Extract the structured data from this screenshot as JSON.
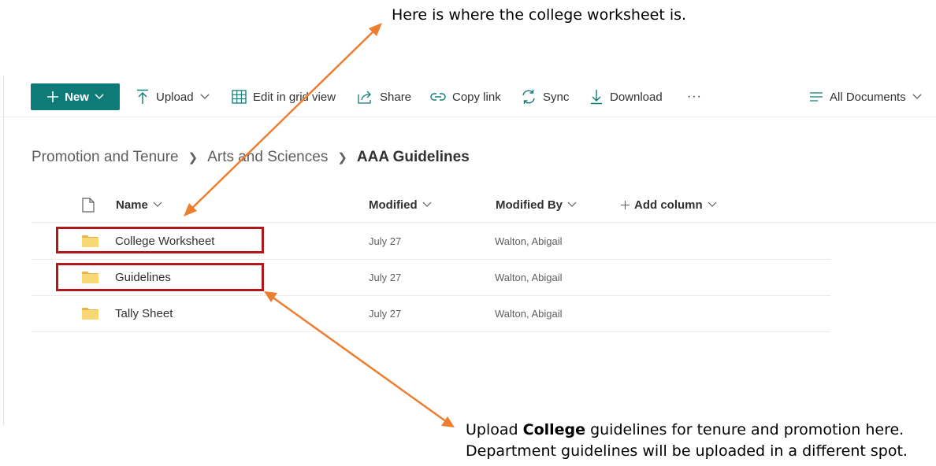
{
  "annotations": {
    "top": "Here is where the college worksheet is.",
    "bottom_line1_prefix": "Upload ",
    "bottom_line1_bold": "College",
    "bottom_line1_suffix": " guidelines for tenure and promotion here.",
    "bottom_line2": "Department guidelines will be uploaded in a different spot."
  },
  "toolbar": {
    "new_label": "New",
    "upload_label": "Upload",
    "edit_grid_label": "Edit in grid view",
    "share_label": "Share",
    "copy_link_label": "Copy link",
    "sync_label": "Sync",
    "download_label": "Download",
    "more_label": "···",
    "view_label": "All Documents"
  },
  "breadcrumb": {
    "items": [
      "Promotion and Tenure",
      "Arts and Sciences"
    ],
    "current": "AAA Guidelines"
  },
  "columns": {
    "name": "Name",
    "modified": "Modified",
    "modified_by": "Modified By",
    "add_column": "Add column"
  },
  "rows": [
    {
      "name": "College Worksheet",
      "modified": "July 27",
      "modified_by": "Walton, Abigail",
      "icon": "folder-icon"
    },
    {
      "name": "Guidelines",
      "modified": "July 27",
      "modified_by": "Walton, Abigail",
      "icon": "folder-icon"
    },
    {
      "name": "Tally Sheet",
      "modified": "July 27",
      "modified_by": "Walton, Abigail",
      "icon": "folder-icon"
    }
  ],
  "colors": {
    "accent": "#0f7b78",
    "highlight_box": "#b01919",
    "arrow": "#ed7d31",
    "folder": "#f8d775"
  }
}
